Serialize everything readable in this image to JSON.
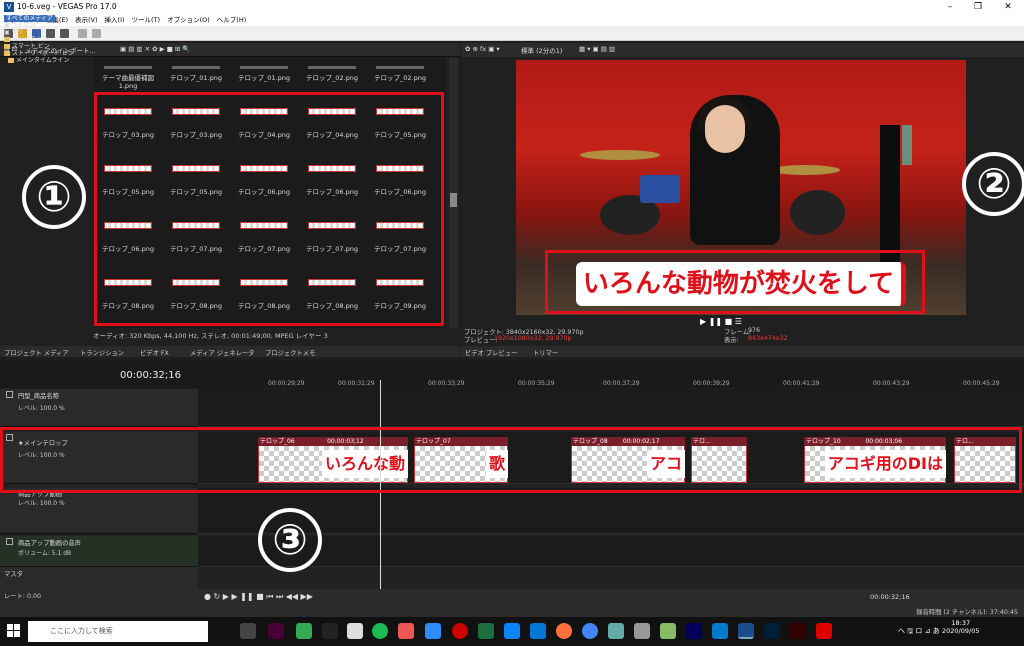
{
  "window": {
    "icon": "V",
    "title": "10-6.veg - VEGAS Pro 17.0",
    "minimize": "–",
    "maximize": "❐",
    "close": "✕"
  },
  "menu": [
    "ファイル(F)",
    "編集(E)",
    "表示(V)",
    "挿入(I)",
    "ツール(T)",
    "オプション(O)",
    "ヘルプ(H)"
  ],
  "media_panel": {
    "toolbar_label": "メディアのインポート...",
    "tree": [
      "すべてのメディア",
      "ライブ列",
      "タグ",
      "メディア ビン",
      "スマート ビン",
      "ストーリーボード ビン",
      "メインタイムライン"
    ],
    "top_row": [
      "テーマ曲最優補図1.png",
      "テロップ_01.png",
      "テロップ_01.png",
      "テロップ_02.png",
      "テロップ_02.png"
    ],
    "files": [
      [
        "テロップ_03.png",
        "テロップ_03.png",
        "テロップ_04.png",
        "テロップ_04.png",
        "テロップ_05.png"
      ],
      [
        "テロップ_05.png",
        "テロップ_05.png",
        "テロップ_06.png",
        "テロップ_06.png",
        "テロップ_06.png"
      ],
      [
        "テロップ_06.png",
        "テロップ_07.png",
        "テロップ_07.png",
        "テロップ_07.png",
        "テロップ_07.png"
      ],
      [
        "テロップ_08.png",
        "テロップ_08.png",
        "テロップ_08.png",
        "テロップ_08.png",
        "テロップ_09.png"
      ]
    ],
    "audio_status": "オーディオ: 320 Kbps, 44,100 Hz, ステレオ, 00:01:49;00, MPEG レイヤー 3",
    "tabs": [
      "プロジェクト メディア",
      "トランジション",
      "ビデオ FX",
      "メディア ジェネレータ",
      "プロジェクトメモ"
    ]
  },
  "annotation": {
    "one": "①",
    "two": "②",
    "three": "③"
  },
  "preview": {
    "toolbar_label": "標準 (2分の1)",
    "caption": "いろんな動物が焚火をして",
    "transport": "▶ ❚❚ ■ ☰",
    "project_label": "プロジェクト: 3840x2160x32, 29.970p",
    "preview_label": "プレビュー:",
    "preview_value": "1920x1080x32, 29.970p",
    "frame_label": "フレーム:",
    "frame_value": "976",
    "display_label": "表示:",
    "display_value": "843x474x32",
    "tabs": [
      "ビデオ プレビュー",
      "トリマー"
    ]
  },
  "timeline": {
    "timecode": "00:00:32;16",
    "ruler": [
      "00:00:29;29",
      "00:00:31;29",
      "00:00:33;29",
      "00:00:35;29",
      "00:00:37;29",
      "00:00:39;29",
      "00:00:41;29",
      "00:00:43;29",
      "00:00:45;29"
    ],
    "tracks": [
      {
        "name": "円型_商品名称",
        "level": "レベル:  100.0 %"
      },
      {
        "name": "★メインテロップ",
        "level": "レベル:  100.0 %"
      },
      {
        "name": "商品アップ動画",
        "level": "レベル:  100.0 %"
      },
      {
        "name": "商品アップ動画の音声",
        "level": "ボリューム:  5.1 dB"
      }
    ],
    "clips": [
      {
        "label": "テロップ_06",
        "time": "00:00:03;12",
        "text": "いろんな動"
      },
      {
        "label": "テロップ_07",
        "time": "",
        "text": "歌"
      },
      {
        "label": "テロップ_08",
        "time": "00:00:02;17",
        "text": "アコ"
      },
      {
        "label": "テロ...",
        "time": "",
        "text": ""
      },
      {
        "label": "テロップ_10",
        "time": "00:00:03;06",
        "text": "アコギ用のDIは"
      },
      {
        "label": "テロ...",
        "time": "",
        "text": ""
      }
    ],
    "master_label": "マスタ",
    "rate_label": "レート: 0.00",
    "end_timecode": "00:00:32;16",
    "record_time": "録音時間 (2 チャンネル): 37:40:45"
  },
  "taskbar": {
    "search_placeholder": "ここに入力して検索",
    "time": "18:37",
    "date": "2020/09/05",
    "tray": "へ 🖫 ロ ⊿ あ"
  }
}
